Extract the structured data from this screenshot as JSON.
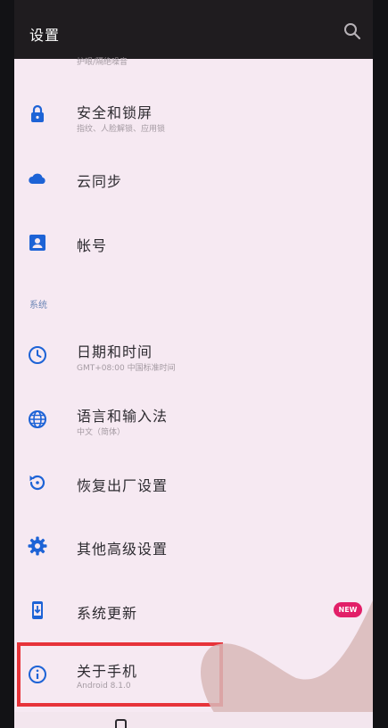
{
  "app_bar": {
    "title": "设置"
  },
  "partial_top": {
    "subtitle": "护眼/隔绝噪音"
  },
  "items": [
    {
      "title": "安全和锁屏",
      "subtitle": "指纹、人脸解锁、应用锁",
      "icon": "lock-icon"
    },
    {
      "title": "云同步",
      "subtitle": "",
      "icon": "cloud-icon"
    },
    {
      "title": "帐号",
      "subtitle": "",
      "icon": "account-icon"
    }
  ],
  "section": {
    "label": "系统"
  },
  "system_items": [
    {
      "title": "日期和时间",
      "subtitle": "GMT+08:00 中国标准时间",
      "icon": "clock-icon"
    },
    {
      "title": "语言和输入法",
      "subtitle": "中文（简体）",
      "icon": "globe-icon"
    },
    {
      "title": "恢复出厂设置",
      "subtitle": "",
      "icon": "restore-icon"
    },
    {
      "title": "其他高级设置",
      "subtitle": "",
      "icon": "gear-icon"
    },
    {
      "title": "系统更新",
      "subtitle": "",
      "icon": "system-update-icon",
      "badge": "NEW"
    },
    {
      "title": "关于手机",
      "subtitle": "Android 8.1.0",
      "icon": "info-icon"
    }
  ],
  "colors": {
    "accent": "#1d63d6",
    "background": "#f6e9f2",
    "app_bar": "#1f1c1f",
    "badge": "#e21f68",
    "highlight": "#e7333a"
  }
}
